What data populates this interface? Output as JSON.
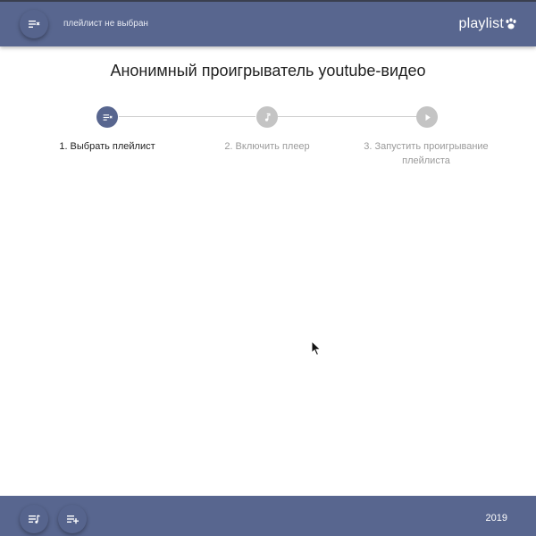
{
  "header": {
    "subtitle": "плейлист не выбран",
    "brand": "playlist",
    "menu_icon": "playlist-remove-icon",
    "brand_icon": "paw-icon"
  },
  "main": {
    "title": "Анонимный проигрыватель youtube-видео",
    "steps": [
      {
        "label": "1. Выбрать плейлист",
        "icon": "playlist-remove-icon",
        "state": "active"
      },
      {
        "label": "2. Включить плеер",
        "icon": "music-note-icon",
        "state": "inactive"
      },
      {
        "label": "3. Запустить проигрывание плейлиста",
        "icon": "play-icon",
        "state": "inactive"
      }
    ]
  },
  "footer": {
    "year": "2019",
    "buttons": [
      {
        "icon": "playlist-music-icon"
      },
      {
        "icon": "playlist-add-icon"
      }
    ]
  },
  "colors": {
    "bar": "#58668f",
    "active_step": "#58668f",
    "inactive_step": "#c4c4c4"
  }
}
